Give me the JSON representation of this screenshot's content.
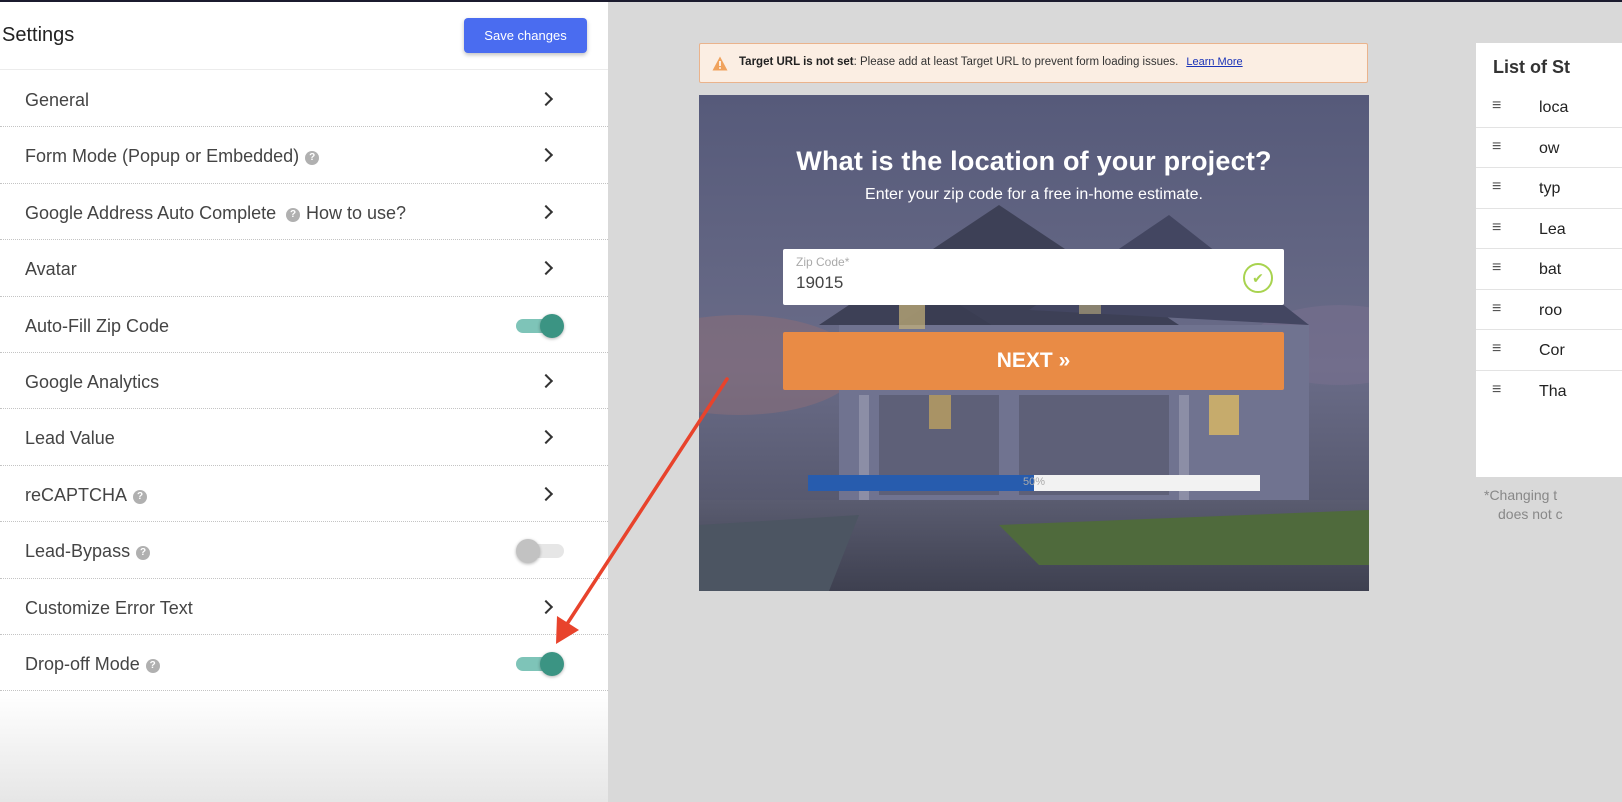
{
  "settings": {
    "title": "Settings",
    "save_label": "Save changes",
    "rows": [
      {
        "label": "General",
        "control": "chevron"
      },
      {
        "label": "Form Mode (Popup or Embedded)",
        "control": "chevron",
        "help": true
      },
      {
        "label": "Google Address Auto Complete",
        "control": "chevron",
        "help_link": "How to use?"
      },
      {
        "label": "Avatar",
        "control": "chevron"
      },
      {
        "label": "Auto-Fill Zip Code",
        "control": "toggle",
        "on": true
      },
      {
        "label": "Google Analytics",
        "control": "chevron"
      },
      {
        "label": "Lead Value",
        "control": "chevron"
      },
      {
        "label": "reCAPTCHA",
        "control": "chevron",
        "help": true
      },
      {
        "label": "Lead-Bypass",
        "control": "toggle",
        "on": false,
        "help": true
      },
      {
        "label": "Customize Error Text",
        "control": "chevron"
      },
      {
        "label": "Drop-off Mode",
        "control": "toggle",
        "on": true,
        "help": true
      }
    ]
  },
  "alert": {
    "bold": "Target URL is not set",
    "message": ": Please add at least Target URL to prevent form loading issues.",
    "link": "Learn More"
  },
  "form": {
    "title": "What is the location of your project?",
    "subtitle": "Enter your zip code for a free in-home estimate.",
    "zip_label": "Zip Code*",
    "zip_value": "19015",
    "next_label": "NEXT »",
    "progress": 50,
    "progress_label": "50%"
  },
  "steps": {
    "title": "List of St",
    "items": [
      "loca",
      "ow",
      "typ",
      "Lea",
      "bat",
      "roo",
      "Cor",
      "Tha"
    ],
    "note_lines": [
      "*Changing t",
      "does not c"
    ]
  },
  "colors": {
    "accent": "#4a6cf0",
    "toggle_on": "#3b9483",
    "next_button": "#e98b45",
    "progress_fill": "#275cae",
    "annotation_arrow": "#e8432c"
  }
}
